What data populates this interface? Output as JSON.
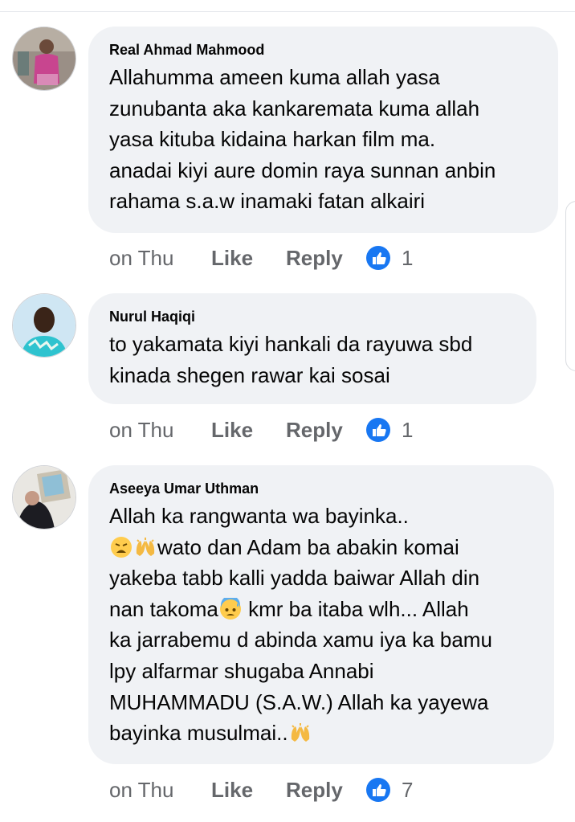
{
  "comments": [
    {
      "author": "Real Ahmad Mahmood",
      "text": "Allahumma ameen kuma allah yasa\nzunubanta aka kankaremata kuma allah\nyasa kituba kidaina harkan film ma.\nanadai kiyi aure domin raya sunnan anbin\nrahama s.a.w inamaki fatan alkairi",
      "time": "on Thu",
      "like_label": "Like",
      "reply_label": "Reply",
      "reaction_count": "1"
    },
    {
      "author": "Nurul Haqiqi",
      "text": "to yakamata kiyi hankali da rayuwa sbd\nkinada shegen rawar kai sosai",
      "time": "on Thu",
      "like_label": "Like",
      "reply_label": "Reply",
      "reaction_count": "1"
    },
    {
      "author": "Aseeya Umar Uthman",
      "text_parts": {
        "line1": "Allah ka rangwanta wa bayinka..",
        "line2": "wato dan Adam ba abakin komai",
        "line3": "yakeba tabb kalli yadda baiwar Allah din",
        "line4a": "nan takoma",
        "line4b": " kmr ba itaba wlh... Allah",
        "line5": "ka jarrabemu d abinda xamu iya ka bamu",
        "line6": "lpy alfarmar shugaba Annabi",
        "line7": "MUHAMMADU (S.A.W.) Allah ka yayewa",
        "line8": "bayinka musulmai.."
      },
      "emojis": [
        "weary-face-emoji",
        "raising-hands-emoji",
        "anxious-sweat-face-emoji",
        "raising-hands-emoji"
      ],
      "time": "on Thu",
      "like_label": "Like",
      "reply_label": "Reply",
      "reaction_count": "7"
    }
  ],
  "colors": {
    "bubble": "#f0f2f5",
    "secondary_text": "#65676b",
    "like_blue": "#1877f2"
  }
}
